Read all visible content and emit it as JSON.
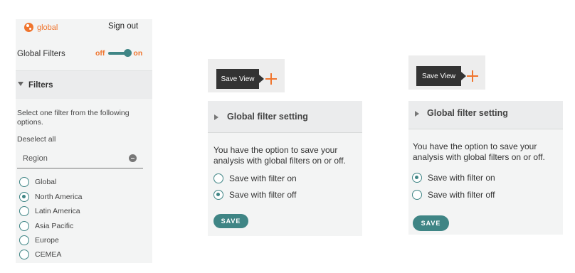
{
  "app": {
    "brand": "global",
    "sign_out": "Sign out"
  },
  "global_filters": {
    "label": "Global Filters",
    "off_label": "off",
    "on_label": "on",
    "state": "on"
  },
  "filters_panel": {
    "header": "Filters",
    "hint": "Select one filter from the following options.",
    "deselect_all": "Deselect all",
    "region_value": "Region",
    "options": [
      {
        "label": "Global",
        "selected": false
      },
      {
        "label": "North America",
        "selected": true
      },
      {
        "label": "Latin America",
        "selected": false
      },
      {
        "label": "Asia Pacific",
        "selected": false
      },
      {
        "label": "Europe",
        "selected": false
      },
      {
        "label": "CEMEA",
        "selected": false
      }
    ]
  },
  "save_view": {
    "label": "Save View"
  },
  "cards": [
    {
      "title": "Global filter setting",
      "description": "You have the option to save your analysis with global filters on or off.",
      "options": [
        {
          "label": "Save with filter on",
          "selected": false
        },
        {
          "label": "Save with filter off",
          "selected": true
        }
      ],
      "button": "SAVE"
    },
    {
      "title": "Global filter setting",
      "description": "You have the option to save your analysis with global filters on or off.",
      "options": [
        {
          "label": "Save with filter on",
          "selected": true
        },
        {
          "label": "Save with filter off",
          "selected": false
        }
      ],
      "button": "SAVE"
    }
  ],
  "colors": {
    "accent_orange": "#f0752e",
    "teal": "#3f8585",
    "dark": "#333333",
    "panel_bg": "#f3f4f4"
  }
}
